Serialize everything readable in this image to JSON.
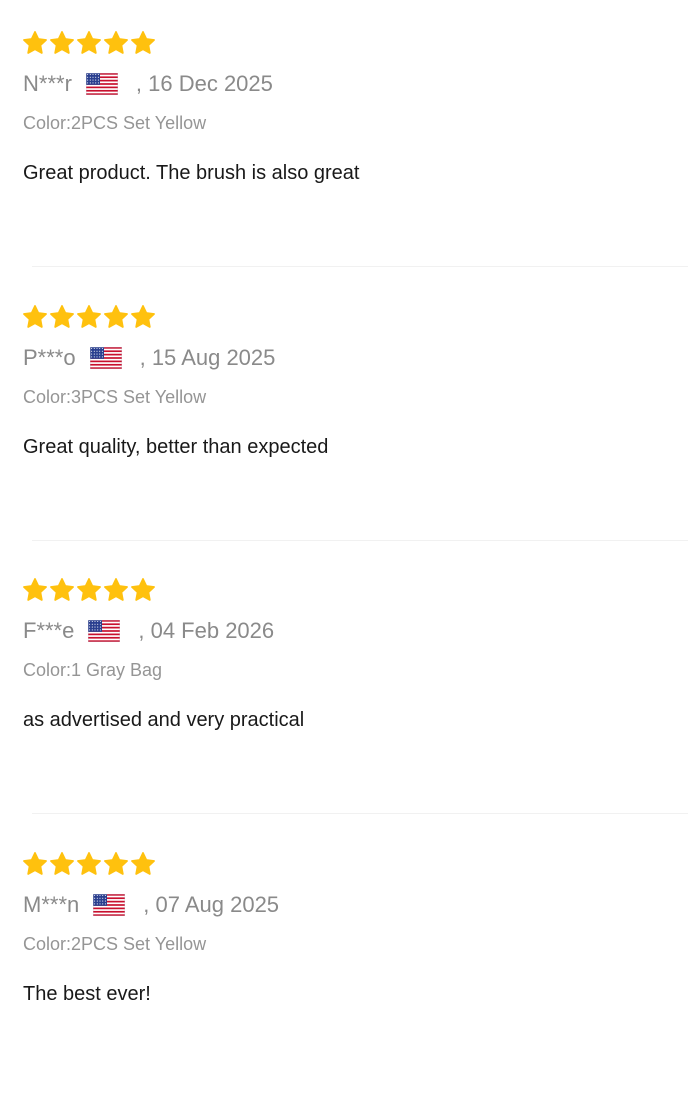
{
  "colors": {
    "star": "#FFC10E",
    "meta_text": "#8A8A8A",
    "body_text": "#191919",
    "divider": "#F1F1F1"
  },
  "reviews": [
    {
      "rating": 5,
      "reviewer": "N***r",
      "country_icon": "us-flag-icon",
      "date": ", 16 Dec 2025",
      "sku": "Color:2PCS Set Yellow",
      "text": "Great product. The brush is also great"
    },
    {
      "rating": 5,
      "reviewer": "P***o",
      "country_icon": "us-flag-icon",
      "date": ", 15 Aug 2025",
      "sku": "Color:3PCS Set Yellow",
      "text": "Great quality, better than expected"
    },
    {
      "rating": 5,
      "reviewer": "F***e",
      "country_icon": "us-flag-icon",
      "date": ", 04 Feb 2026",
      "sku": "Color:1 Gray Bag",
      "text": "as advertised and very practical"
    },
    {
      "rating": 5,
      "reviewer": "M***n",
      "country_icon": "us-flag-icon",
      "date": ", 07 Aug 2025",
      "sku": "Color:2PCS Set Yellow",
      "text": "The best ever!"
    }
  ]
}
